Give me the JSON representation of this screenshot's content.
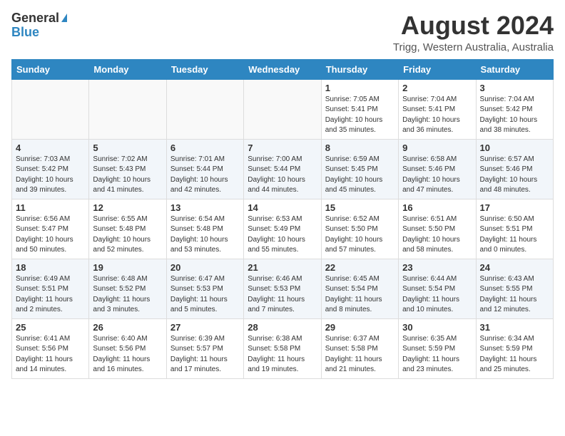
{
  "header": {
    "logo_general": "General",
    "logo_blue": "Blue",
    "month_year": "August 2024",
    "location": "Trigg, Western Australia, Australia"
  },
  "calendar": {
    "days_of_week": [
      "Sunday",
      "Monday",
      "Tuesday",
      "Wednesday",
      "Thursday",
      "Friday",
      "Saturday"
    ],
    "weeks": [
      [
        {
          "day": "",
          "info": ""
        },
        {
          "day": "",
          "info": ""
        },
        {
          "day": "",
          "info": ""
        },
        {
          "day": "",
          "info": ""
        },
        {
          "day": "1",
          "info": "Sunrise: 7:05 AM\nSunset: 5:41 PM\nDaylight: 10 hours\nand 35 minutes."
        },
        {
          "day": "2",
          "info": "Sunrise: 7:04 AM\nSunset: 5:41 PM\nDaylight: 10 hours\nand 36 minutes."
        },
        {
          "day": "3",
          "info": "Sunrise: 7:04 AM\nSunset: 5:42 PM\nDaylight: 10 hours\nand 38 minutes."
        }
      ],
      [
        {
          "day": "4",
          "info": "Sunrise: 7:03 AM\nSunset: 5:42 PM\nDaylight: 10 hours\nand 39 minutes."
        },
        {
          "day": "5",
          "info": "Sunrise: 7:02 AM\nSunset: 5:43 PM\nDaylight: 10 hours\nand 41 minutes."
        },
        {
          "day": "6",
          "info": "Sunrise: 7:01 AM\nSunset: 5:44 PM\nDaylight: 10 hours\nand 42 minutes."
        },
        {
          "day": "7",
          "info": "Sunrise: 7:00 AM\nSunset: 5:44 PM\nDaylight: 10 hours\nand 44 minutes."
        },
        {
          "day": "8",
          "info": "Sunrise: 6:59 AM\nSunset: 5:45 PM\nDaylight: 10 hours\nand 45 minutes."
        },
        {
          "day": "9",
          "info": "Sunrise: 6:58 AM\nSunset: 5:46 PM\nDaylight: 10 hours\nand 47 minutes."
        },
        {
          "day": "10",
          "info": "Sunrise: 6:57 AM\nSunset: 5:46 PM\nDaylight: 10 hours\nand 48 minutes."
        }
      ],
      [
        {
          "day": "11",
          "info": "Sunrise: 6:56 AM\nSunset: 5:47 PM\nDaylight: 10 hours\nand 50 minutes."
        },
        {
          "day": "12",
          "info": "Sunrise: 6:55 AM\nSunset: 5:48 PM\nDaylight: 10 hours\nand 52 minutes."
        },
        {
          "day": "13",
          "info": "Sunrise: 6:54 AM\nSunset: 5:48 PM\nDaylight: 10 hours\nand 53 minutes."
        },
        {
          "day": "14",
          "info": "Sunrise: 6:53 AM\nSunset: 5:49 PM\nDaylight: 10 hours\nand 55 minutes."
        },
        {
          "day": "15",
          "info": "Sunrise: 6:52 AM\nSunset: 5:50 PM\nDaylight: 10 hours\nand 57 minutes."
        },
        {
          "day": "16",
          "info": "Sunrise: 6:51 AM\nSunset: 5:50 PM\nDaylight: 10 hours\nand 58 minutes."
        },
        {
          "day": "17",
          "info": "Sunrise: 6:50 AM\nSunset: 5:51 PM\nDaylight: 11 hours\nand 0 minutes."
        }
      ],
      [
        {
          "day": "18",
          "info": "Sunrise: 6:49 AM\nSunset: 5:51 PM\nDaylight: 11 hours\nand 2 minutes."
        },
        {
          "day": "19",
          "info": "Sunrise: 6:48 AM\nSunset: 5:52 PM\nDaylight: 11 hours\nand 3 minutes."
        },
        {
          "day": "20",
          "info": "Sunrise: 6:47 AM\nSunset: 5:53 PM\nDaylight: 11 hours\nand 5 minutes."
        },
        {
          "day": "21",
          "info": "Sunrise: 6:46 AM\nSunset: 5:53 PM\nDaylight: 11 hours\nand 7 minutes."
        },
        {
          "day": "22",
          "info": "Sunrise: 6:45 AM\nSunset: 5:54 PM\nDaylight: 11 hours\nand 8 minutes."
        },
        {
          "day": "23",
          "info": "Sunrise: 6:44 AM\nSunset: 5:54 PM\nDaylight: 11 hours\nand 10 minutes."
        },
        {
          "day": "24",
          "info": "Sunrise: 6:43 AM\nSunset: 5:55 PM\nDaylight: 11 hours\nand 12 minutes."
        }
      ],
      [
        {
          "day": "25",
          "info": "Sunrise: 6:41 AM\nSunset: 5:56 PM\nDaylight: 11 hours\nand 14 minutes."
        },
        {
          "day": "26",
          "info": "Sunrise: 6:40 AM\nSunset: 5:56 PM\nDaylight: 11 hours\nand 16 minutes."
        },
        {
          "day": "27",
          "info": "Sunrise: 6:39 AM\nSunset: 5:57 PM\nDaylight: 11 hours\nand 17 minutes."
        },
        {
          "day": "28",
          "info": "Sunrise: 6:38 AM\nSunset: 5:58 PM\nDaylight: 11 hours\nand 19 minutes."
        },
        {
          "day": "29",
          "info": "Sunrise: 6:37 AM\nSunset: 5:58 PM\nDaylight: 11 hours\nand 21 minutes."
        },
        {
          "day": "30",
          "info": "Sunrise: 6:35 AM\nSunset: 5:59 PM\nDaylight: 11 hours\nand 23 minutes."
        },
        {
          "day": "31",
          "info": "Sunrise: 6:34 AM\nSunset: 5:59 PM\nDaylight: 11 hours\nand 25 minutes."
        }
      ]
    ]
  }
}
